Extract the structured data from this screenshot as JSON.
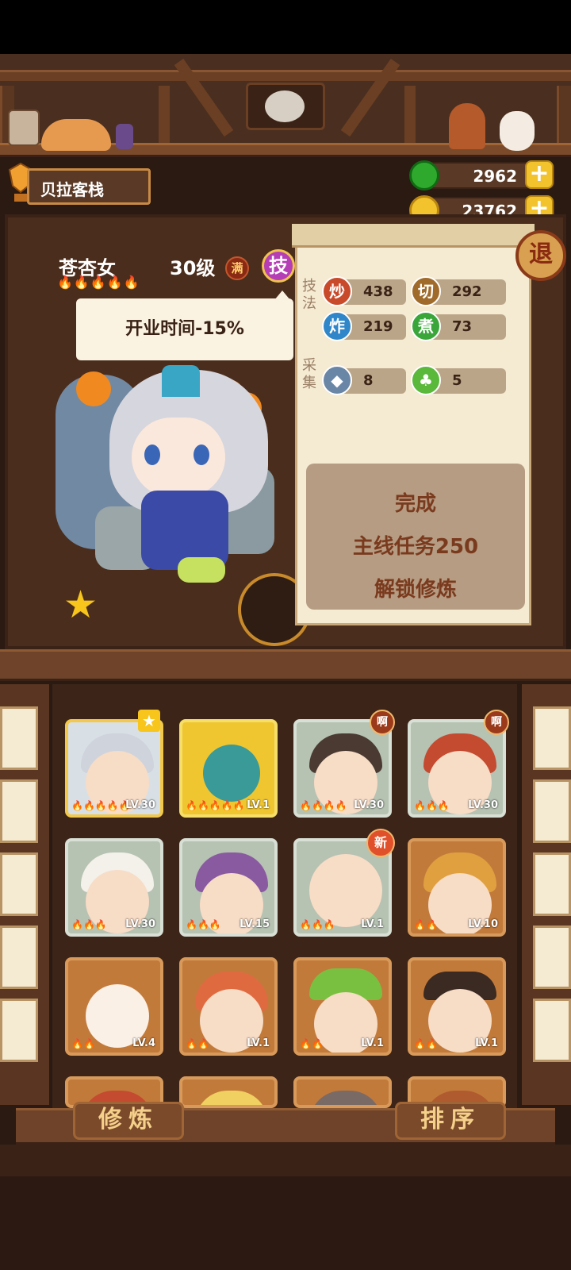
{
  "inn": {
    "name": "贝拉客栈"
  },
  "currency": {
    "jade": "2962",
    "coins": "23762"
  },
  "exit_label": "退",
  "character": {
    "name": "苍杏女",
    "level": "30级",
    "max_badge": "满",
    "skill_button": "技",
    "flames": "🔥🔥🔥🔥🔥",
    "tooltip": "开业时间-15%"
  },
  "stats": {
    "technique_label": "技法",
    "gather_label": "采集",
    "stir_fry": {
      "icon": "炒",
      "value": "438"
    },
    "cut": {
      "icon": "切",
      "value": "292"
    },
    "fry": {
      "icon": "炸",
      "value": "219"
    },
    "boil": {
      "icon": "煮",
      "value": "73"
    },
    "fish": {
      "value": "8"
    },
    "veg": {
      "value": "5"
    }
  },
  "unlock": {
    "line1": "完成",
    "line2": "主线任务250",
    "line3": "解锁修炼"
  },
  "roster": [
    {
      "level": "LV.30",
      "flames": "🔥🔥🔥🔥🔥",
      "badge": ""
    },
    {
      "level": "LV.1",
      "flames": "🔥🔥🔥🔥🔥",
      "badge": ""
    },
    {
      "level": "LV.30",
      "flames": "🔥🔥🔥🔥",
      "badge": "啊"
    },
    {
      "level": "LV.30",
      "flames": "🔥🔥🔥",
      "badge": "啊"
    },
    {
      "level": "LV.30",
      "flames": "🔥🔥🔥",
      "badge": ""
    },
    {
      "level": "LV.15",
      "flames": "🔥🔥🔥",
      "badge": ""
    },
    {
      "level": "LV.1",
      "flames": "🔥🔥🔥",
      "badge": "新"
    },
    {
      "level": "LV.10",
      "flames": "🔥🔥",
      "badge": ""
    },
    {
      "level": "LV.4",
      "flames": "🔥🔥",
      "badge": ""
    },
    {
      "level": "LV.1",
      "flames": "🔥🔥",
      "badge": ""
    },
    {
      "level": "LV.1",
      "flames": "🔥🔥",
      "badge": ""
    },
    {
      "level": "LV.1",
      "flames": "🔥🔥",
      "badge": ""
    }
  ],
  "buttons": {
    "cultivate": "修炼",
    "sort": "排序"
  },
  "colors": {
    "accent_gold": "#f3c32e",
    "panel_brown": "#4a2d1d",
    "scroll_paper": "#f5ead2",
    "skill_purple": "#b53db6"
  }
}
